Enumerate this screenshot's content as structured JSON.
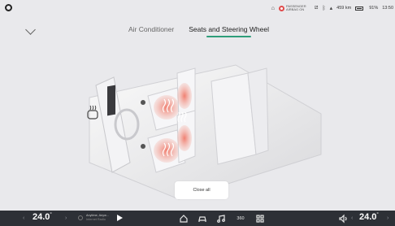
{
  "status": {
    "airbag_text": "PASSENGER AIRBAG ON",
    "range": "459 km",
    "battery": "91%",
    "time": "13:50"
  },
  "tabs": [
    {
      "label": "Air Conditioner",
      "active": false
    },
    {
      "label": "Seats and Steering Wheel",
      "active": true
    }
  ],
  "actions": {
    "close_all": "Close all"
  },
  "dock": {
    "left_temp": "24.0",
    "right_temp": "24.0",
    "temp_unit": "°",
    "media_title": "Anytime, Anyw...",
    "media_subtitle": "Internet Radio",
    "label_360": "360"
  },
  "colors": {
    "accent": "#2e9e7a",
    "heat": "#e85a4a",
    "dock": "#2d3036"
  }
}
